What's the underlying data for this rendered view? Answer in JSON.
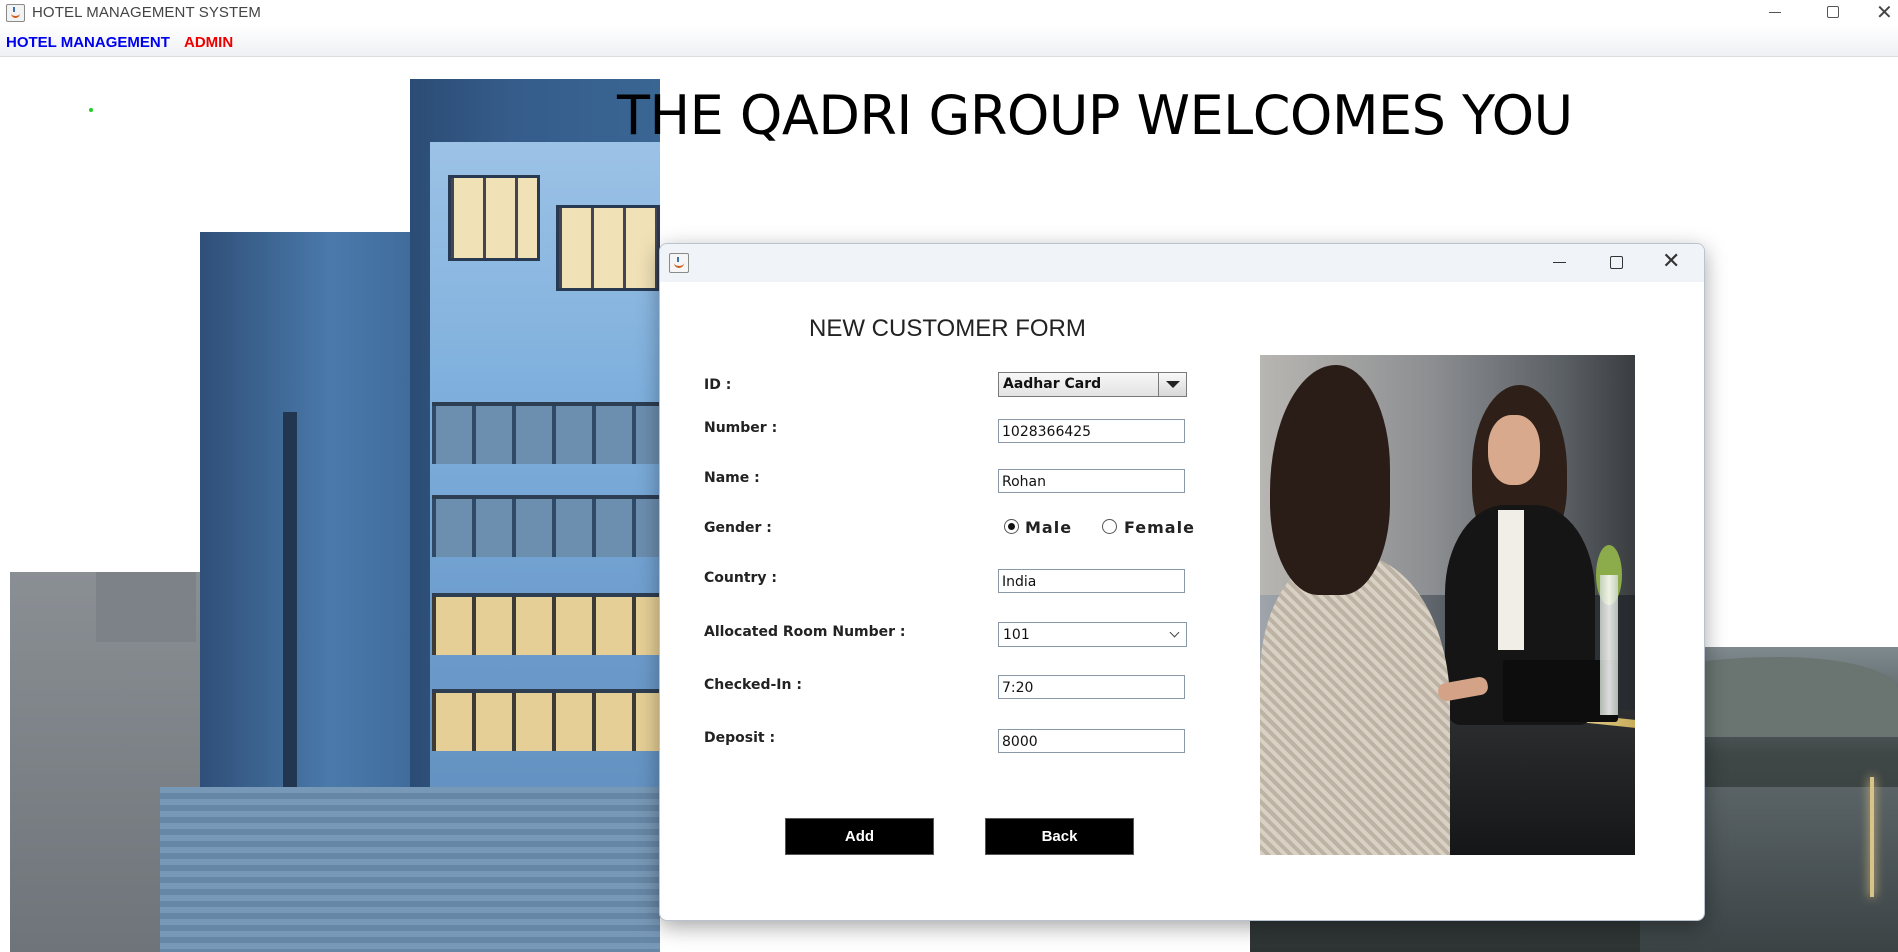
{
  "window": {
    "title": "HOTEL MANAGEMENT SYSTEM",
    "controls": [
      "minimize",
      "maximize",
      "close"
    ]
  },
  "menu": {
    "hotel_management": "HOTEL MANAGEMENT",
    "admin": "ADMIN",
    "colors": {
      "hotel_management": "#0000f0",
      "admin": "#ee0000"
    }
  },
  "background": {
    "headline": "THE QADRI GROUP WELCOMES YOU",
    "image": "hotel-building-photo"
  },
  "dialog": {
    "controls": [
      "minimize",
      "maximize",
      "close"
    ],
    "title": "NEW CUSTOMER FORM",
    "fields": {
      "id": {
        "label": "ID :",
        "value": "Aadhar Card"
      },
      "number": {
        "label": "Number :",
        "value": "1028366425"
      },
      "name": {
        "label": "Name :",
        "value": "Rohan"
      },
      "gender": {
        "label": "Gender :",
        "options": [
          "Male",
          "Female"
        ],
        "selected": "Male"
      },
      "country": {
        "label": "Country :",
        "value": "India"
      },
      "room": {
        "label": "Allocated Room Number :",
        "value": "101"
      },
      "checked_in": {
        "label": "Checked-In :",
        "value": "7:20"
      },
      "deposit": {
        "label": "Deposit :",
        "value": "8000"
      }
    },
    "buttons": {
      "add": "Add",
      "back": "Back"
    },
    "image": "reception-desk-photo"
  }
}
